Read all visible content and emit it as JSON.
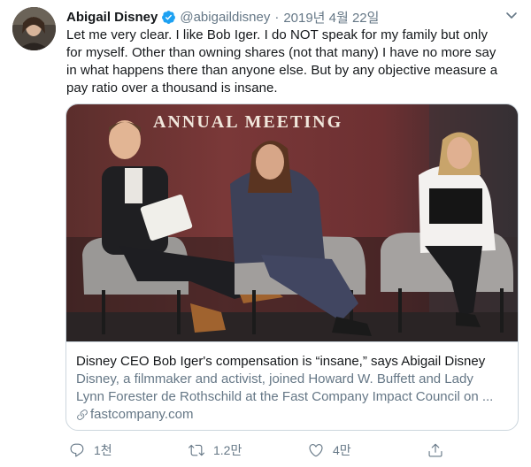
{
  "tweet": {
    "display_name": "Abigail Disney",
    "handle": "@abigaildisney",
    "separator": "·",
    "date": "2019년 4월 22일",
    "text_lines": [
      "Let me very clear. I like Bob Iger. I do NOT speak for my family but only",
      "for myself. Other than owning shares (not that many) I have no more say",
      "in what happens there than anyone else. But by any objective measure a",
      "pay ratio over a thousand is insane."
    ]
  },
  "card": {
    "image_banner": "ANNUAL MEETING",
    "title": "Disney CEO Bob Iger's compensation is “insane,” says Abigail Disney",
    "description_lines": [
      "Disney, a filmmaker and activist, joined Howard W. Buffett and Lady",
      "Lynn Forester de Rothschild at the Fast Company Impact Council on ..."
    ],
    "domain": "fastcompany.com"
  },
  "actions": {
    "reply_count": "1천",
    "retweet_count": "1.2만",
    "like_count": "4만"
  },
  "colors": {
    "text_primary": "#14171a",
    "text_secondary": "#657786",
    "border": "#ccd6dd",
    "verified_blue": "#1da1f2"
  },
  "icons": [
    "avatar",
    "verified-badge-icon",
    "chevron-down-icon",
    "link-icon",
    "reply-icon",
    "retweet-icon",
    "like-icon",
    "share-icon"
  ]
}
